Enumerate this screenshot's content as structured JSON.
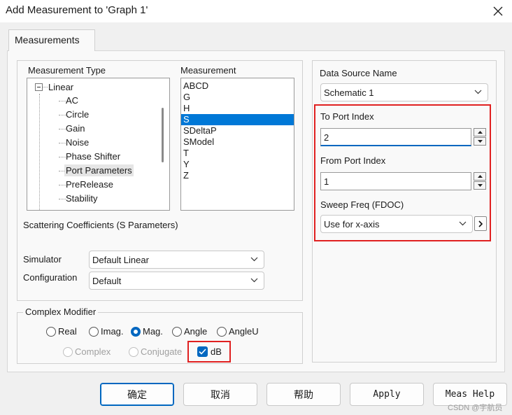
{
  "window": {
    "title": "Add Measurement to 'Graph 1'"
  },
  "tabs": [
    {
      "label": "Measurements"
    }
  ],
  "measurement_type": {
    "label": "Measurement Type",
    "items": [
      {
        "label": "Linear"
      },
      {
        "label": "AC"
      },
      {
        "label": "Circle"
      },
      {
        "label": "Gain"
      },
      {
        "label": "Noise"
      },
      {
        "label": "Phase Shifter"
      },
      {
        "label": "Port Parameters"
      },
      {
        "label": "PreRelease"
      },
      {
        "label": "Stability"
      }
    ]
  },
  "measurement": {
    "label": "Measurement",
    "items": [
      "ABCD",
      "G",
      "H",
      "S",
      "SDeltaP",
      "SModel",
      "T",
      "Y",
      "Z"
    ],
    "selected": "S"
  },
  "description": "Scattering Coefficients (S Parameters)",
  "simulator": {
    "label": "Simulator",
    "value": "Default Linear"
  },
  "configuration": {
    "label": "Configuration",
    "value": "Default"
  },
  "complex_modifier": {
    "label": "Complex Modifier",
    "options": [
      "Real",
      "Imag.",
      "Mag.",
      "Angle",
      "AngleU"
    ],
    "selected": "Mag.",
    "disabled_options": [
      "Complex",
      "Conjugate"
    ],
    "db_label": "dB",
    "db_checked": true
  },
  "data_source": {
    "label": "Data Source Name",
    "value": "Schematic 1"
  },
  "to_port": {
    "label": "To Port Index",
    "value": "2"
  },
  "from_port": {
    "label": "From Port Index",
    "value": "1"
  },
  "sweep": {
    "label": "Sweep Freq (FDOC)",
    "value": "Use for x-axis"
  },
  "buttons": {
    "ok": "确定",
    "cancel": "取消",
    "help": "帮助",
    "apply": "Apply",
    "meas_help": "Meas Help"
  },
  "watermark": "CSDN @宇航员",
  "colors": {
    "accent": "#0067c0",
    "selection": "#0078d7",
    "highlight_box": "#e02020"
  },
  "icons": {
    "close": "close-icon",
    "collapse": "tree-minus-icon",
    "chevron": "chevron-down-icon",
    "arrow": "chevron-right-icon"
  }
}
